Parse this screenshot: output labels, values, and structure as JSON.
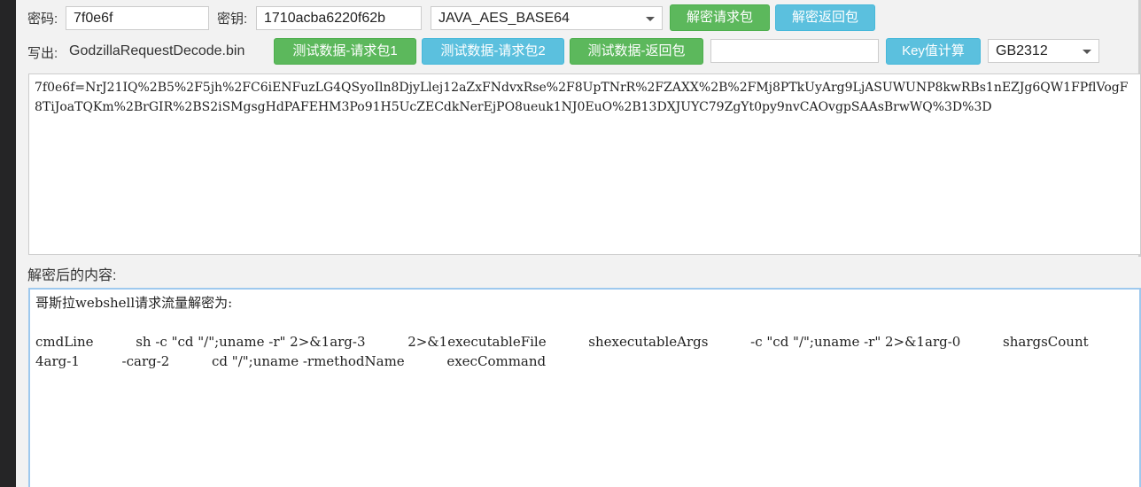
{
  "row1": {
    "password_label": "密码:",
    "password_value": "7f0e6f",
    "key_label": "密钥:",
    "key_value": "1710acba6220f62b",
    "crypto_mode": "JAVA_AES_BASE64",
    "decrypt_request_button": "解密请求包",
    "decrypt_response_button": "解密返回包"
  },
  "row2": {
    "write_label": "写出:",
    "write_filename": "GodzillaRequestDecode.bin",
    "test_request1_button": "测试数据-请求包1",
    "test_request2_button": "测试数据-请求包2",
    "test_response_button": "测试数据-返回包",
    "key_calc_input_value": "",
    "key_calc_button": "Key值计算",
    "encoding": "GB2312"
  },
  "input_text": "7f0e6f=NrJ21IQ%2B5%2F5jh%2FC6iENFuzLG4QSyoIln8DjyLlej12aZxFNdvxRse%2F8UpTNrR%2FZAXX%2B%2FMj8PTkUyArg9LjASUWUNP8kwRBs1nEZJg6QW1FPflVogF8TiJoaTQKm%2BrGIR%2BS2iSMgsgHdPAFEHM3Po91H5UcZECdkNerEjPO8ueuk1NJ0EuO%2B13DXJUYC79ZgYt0py9nvCAOvgpSAAsBrwWQ%3D%3D",
  "output_label": "解密后的内容:",
  "output_text": "哥斯拉webshell请求流量解密为:\n\ncmdLine          sh -c \"cd \"/\";uname -r\" 2>&1arg-3          2>&1executableFile          shexecutableArgs          -c \"cd \"/\";uname -r\" 2>&1arg-0          shargsCount          4arg-1          -carg-2          cd \"/\";uname -rmethodName          execCommand"
}
